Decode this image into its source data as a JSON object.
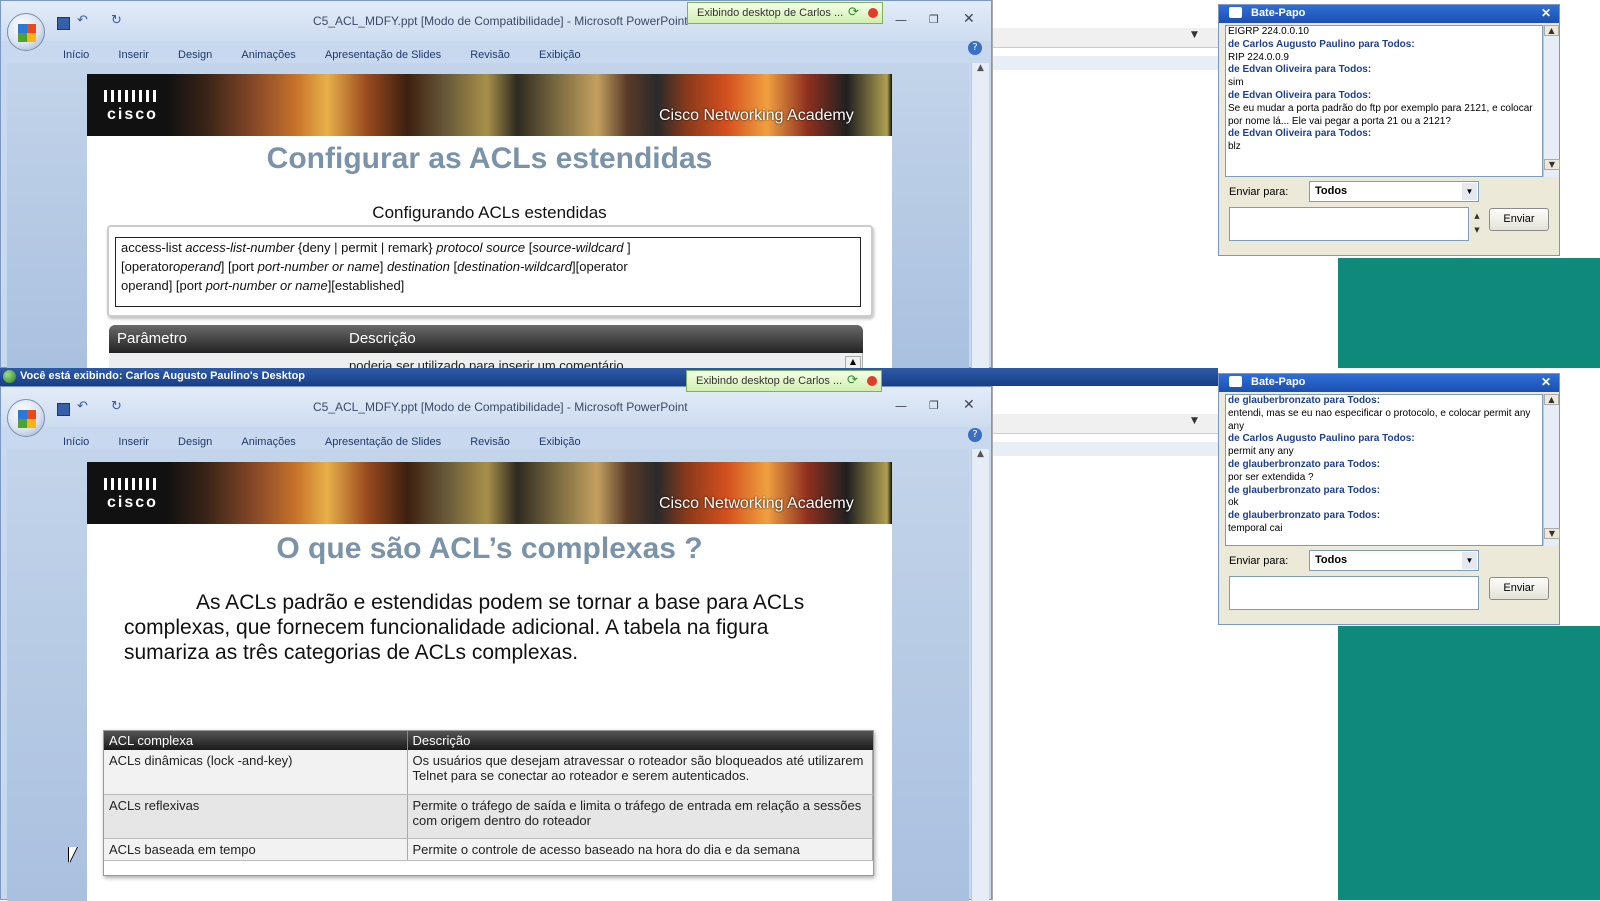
{
  "top": {
    "window_title": "C5_ACL_MDFY.ppt [Modo de Compatibilidade] - Microsoft PowerPoint",
    "ribbon_tabs": [
      "Início",
      "Inserir",
      "Design",
      "Animações",
      "Apresentação de Slides",
      "Revisão",
      "Exibição"
    ],
    "share_badge": "Exibindo desktop de Carlos ...",
    "slide": {
      "brand": "cisco",
      "academy": "Cisco Networking Academy",
      "title": "Configurar as ACLs estendidas",
      "subtitle": "Configurando ACLs estendidas",
      "syntax": {
        "l1a": "access-list ",
        "l1b": "access-list-number",
        "l1c": " {deny | permit | remark} ",
        "l1d": "protocol source",
        "l1e": " [",
        "l1f": "source-wildcard",
        "l1g": " ]",
        "l2a": "[operator",
        "l2b": "operand",
        "l2c": "] [port ",
        "l2d": "port-number or name",
        "l2e": "] ",
        "l2f": "destination",
        "l2g": " [",
        "l2h": "destination-wildcard",
        "l2i": "][operator",
        "l3a": "operand] [port ",
        "l3b": "port-number or name",
        "l3c": "][established]"
      },
      "table_headers": [
        "Parâmetro",
        "Descrição"
      ],
      "table_partial": "poderia ser utilizado para inserir um comentário."
    },
    "chat": {
      "title": "Bate-Papo",
      "lines": [
        {
          "type": "text",
          "text": "EIGRP 224.0.0.10"
        },
        {
          "type": "from",
          "text": "de Carlos Augusto Paulino para Todos:"
        },
        {
          "type": "text",
          "text": "RIP 224.0.0.9"
        },
        {
          "type": "from",
          "text": "de Edvan Oliveira para Todos:"
        },
        {
          "type": "text",
          "text": "sim"
        },
        {
          "type": "from",
          "text": "de Edvan Oliveira para Todos:"
        },
        {
          "type": "text",
          "text": "Se eu mudar a porta padrão do ftp por exemplo para 2121, e colocar por nome lá... Ele vai pegar a porta 21 ou a 2121?"
        },
        {
          "type": "from",
          "text": "de Edvan Oliveira para Todos:"
        },
        {
          "type": "text",
          "text": "blz"
        }
      ],
      "send_to_label": "Enviar para:",
      "send_to_value": "Todos",
      "send_button": "Enviar"
    }
  },
  "viewer_bar": "Você está exibindo: Carlos Augusto Paulino's Desktop",
  "bottom": {
    "window_title": "C5_ACL_MDFY.ppt [Modo de Compatibilidade] - Microsoft PowerPoint",
    "ribbon_tabs": [
      "Início",
      "Inserir",
      "Design",
      "Animações",
      "Apresentação de Slides",
      "Revisão",
      "Exibição"
    ],
    "share_badge": "Exibindo desktop de Carlos ...",
    "slide": {
      "brand": "cisco",
      "academy": "Cisco Networking Academy",
      "title": "O que são ACL’s complexas ?",
      "body": "As ACLs padrão e estendidas podem se tornar a base para ACLs complexas, que fornecem funcionalidade adicional. A tabela na figura sumariza as três categorias de ACLs complexas.",
      "table_headers": [
        "ACL complexa",
        "Descrição"
      ],
      "table_rows": [
        [
          "ACLs dinâmicas (lock -and-key)",
          "Os usuários que desejam atravessar o roteador são bloqueados até utilizarem Telnet para se conectar ao roteador e serem autenticados."
        ],
        [
          "ACLs reflexivas",
          "Permite o tráfego de saída e limita o tráfego de entrada em relação a sessões com origem dentro do roteador"
        ],
        [
          "ACLs baseada em tempo",
          "Permite o controle de acesso baseado na hora do dia e da semana"
        ]
      ]
    },
    "chat": {
      "title": "Bate-Papo",
      "lines": [
        {
          "type": "from",
          "text": "de glauberbronzato para Todos:"
        },
        {
          "type": "text",
          "text": "entendi, mas se eu nao especificar o protocolo, e colocar permit any any"
        },
        {
          "type": "from",
          "text": "de Carlos Augusto Paulino para Todos:"
        },
        {
          "type": "text",
          "text": "permit any any"
        },
        {
          "type": "from",
          "text": "de glauberbronzato para Todos:"
        },
        {
          "type": "text",
          "text": "por ser extendida ?"
        },
        {
          "type": "from",
          "text": "de glauberbronzato para Todos:"
        },
        {
          "type": "text",
          "text": "ok"
        },
        {
          "type": "from",
          "text": "de glauberbronzato para Todos:"
        },
        {
          "type": "text",
          "text": "temporal cai"
        }
      ],
      "send_to_label": "Enviar para:",
      "send_to_value": "Todos",
      "send_button": "Enviar"
    }
  },
  "colors": {
    "accent": "#2f6fd6",
    "teal": "#0f8a7a",
    "ppt_frame": "#cfdcee"
  }
}
